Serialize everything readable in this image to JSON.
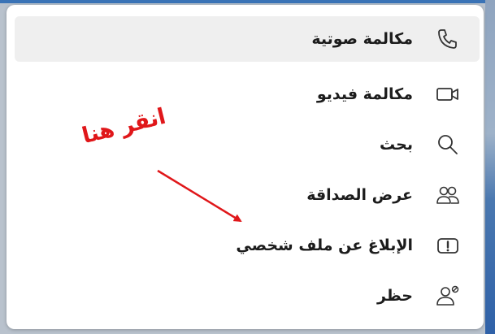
{
  "menu": {
    "items": [
      {
        "label": "مكالمة صوتية",
        "icon": "phone-icon",
        "active": true
      },
      {
        "label": "مكالمة فيديو",
        "icon": "video-camera-icon",
        "active": false
      },
      {
        "label": "بحث",
        "icon": "search-icon",
        "active": false
      },
      {
        "label": "عرض الصداقة",
        "icon": "friends-icon",
        "active": false
      },
      {
        "label": "الإبلاغ عن ملف شخصي",
        "icon": "report-icon",
        "active": false
      },
      {
        "label": "حظر",
        "icon": "block-user-icon",
        "active": false
      }
    ]
  },
  "annotation": {
    "text": "انقر هنا",
    "color": "#e0171a"
  }
}
